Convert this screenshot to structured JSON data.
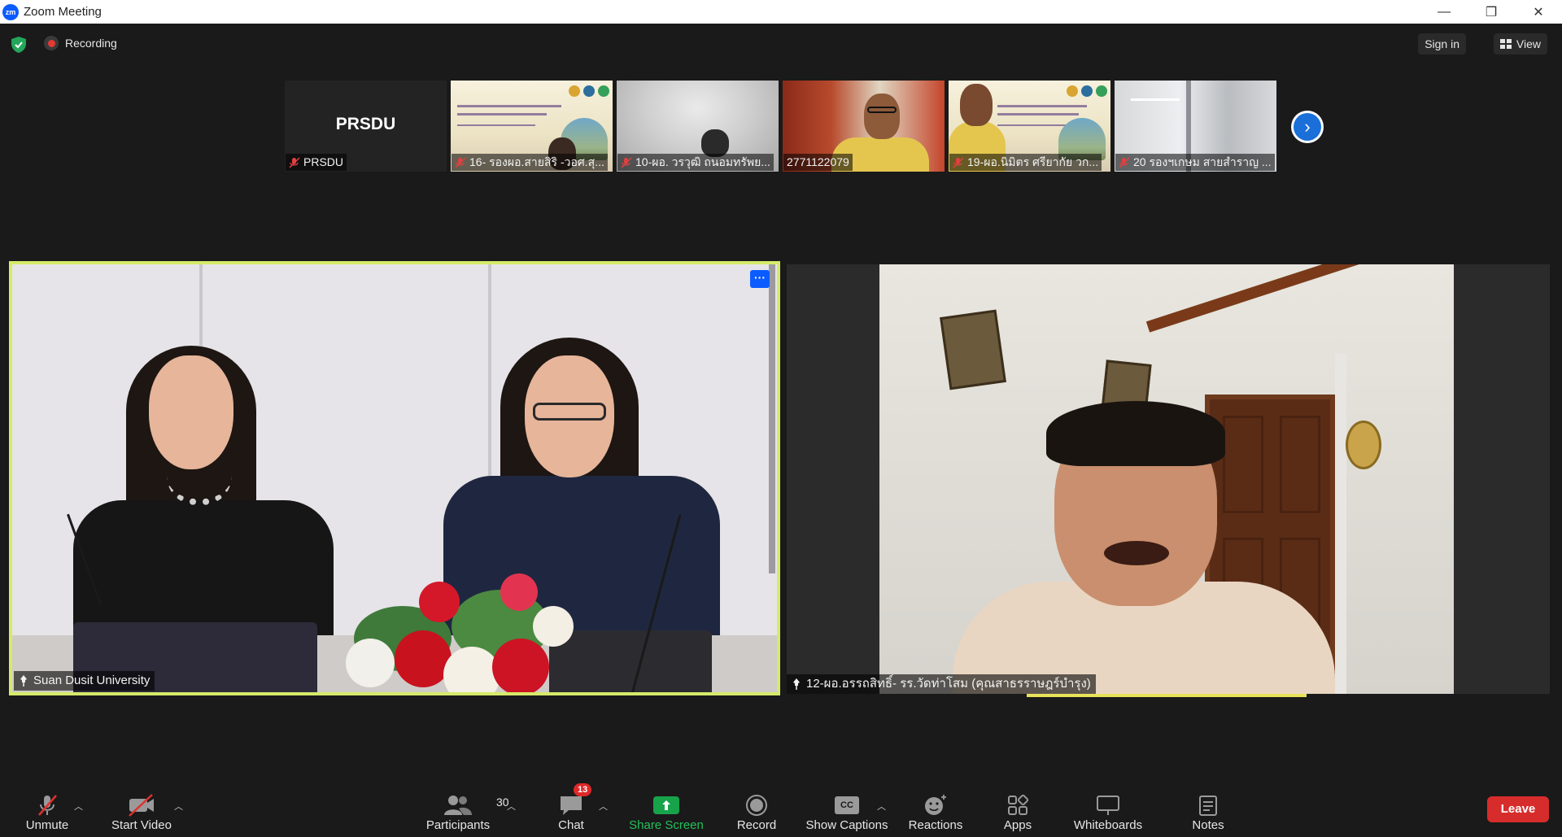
{
  "window": {
    "logo_text": "zm",
    "title": "Zoom Meeting",
    "minimize": "—",
    "restore": "❐",
    "close": "✕"
  },
  "topbar": {
    "recording_label": "Recording",
    "sign_in": "Sign in",
    "view": "View"
  },
  "thumbnails": [
    {
      "name": "PRSDU",
      "big_label": "PRSDU",
      "muted": true
    },
    {
      "name": "16- รองผอ.สายสิริ -วอศ.สุ...",
      "muted": true
    },
    {
      "name": "10-ผอ. วรวุฒิ ถนอมทรัพย...",
      "muted": true
    },
    {
      "name": "2771122079",
      "muted": false
    },
    {
      "name": "19-ผอ.นิมิตร ศรียากัย วก...",
      "muted": true
    },
    {
      "name": "20 รองฯเกษม สายสำราญ ...",
      "muted": true
    }
  ],
  "main": {
    "left_name": "Suan Dusit University",
    "more_label": "···",
    "right_name": "12-ผอ.อรรถสิทธิ์- รร.วัดท่าโสม (คุณสาธรราษฎร์บำรุง)"
  },
  "toolbar": {
    "unmute": "Unmute",
    "start_video": "Start Video",
    "participants": "Participants",
    "participants_count": "30",
    "chat": "Chat",
    "chat_badge": "13",
    "share_screen": "Share Screen",
    "record": "Record",
    "show_captions": "Show Captions",
    "cc": "CC",
    "reactions": "Reactions",
    "apps": "Apps",
    "whiteboards": "Whiteboards",
    "notes": "Notes",
    "leave": "Leave"
  },
  "colors": {
    "active_speaker_border": "#d6ea6a",
    "share_green": "#17a34a",
    "leave_red": "#d72c2c",
    "zoom_blue": "#0b5cff"
  }
}
